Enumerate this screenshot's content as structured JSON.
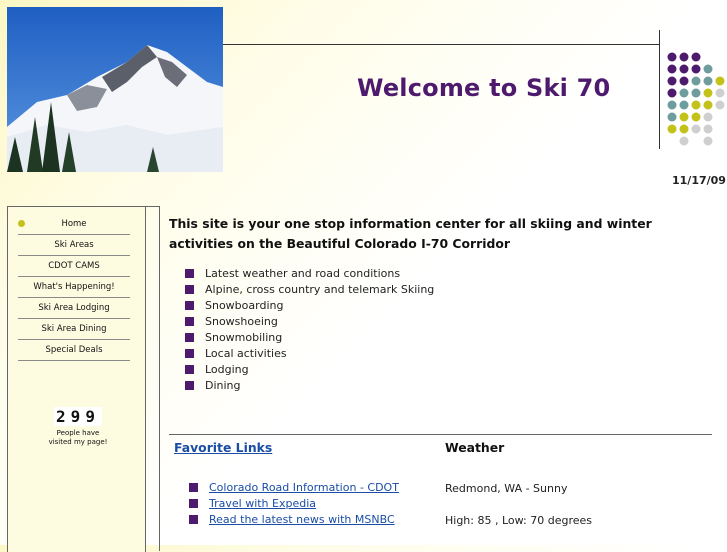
{
  "header": {
    "title": "Welcome to Ski 70",
    "date": "11/17/09"
  },
  "sidebar": {
    "items": [
      {
        "label": "Home",
        "active": true
      },
      {
        "label": "Ski Areas"
      },
      {
        "label": "CDOT CAMS"
      },
      {
        "label": "What's Happening!"
      },
      {
        "label": "Ski Area Lodging"
      },
      {
        "label": "Ski Area Dining"
      },
      {
        "label": "Special Deals"
      }
    ],
    "counter": {
      "value": "299",
      "caption_line1": "People have",
      "caption_line2": "visited my page!"
    }
  },
  "main": {
    "intro": "This site is your one stop information center for all skiing and winter activities on the Beautiful Colorado I-70 Corridor",
    "features": [
      "Latest weather and road conditions",
      "Alpine, cross country and telemark Skiing",
      "Snowboarding",
      "Snowshoeing",
      "Snowmobiling",
      "Local activities",
      "Lodging",
      "Dining"
    ],
    "favorite_links_title": "Favorite Links",
    "links": [
      "Colorado Road Information - CDOT",
      "Travel with Expedia",
      "Read the latest news with MSNBC"
    ],
    "weather_title": "Weather",
    "weather_location": "Redmond, WA - Sunny",
    "weather_temps": "High: 85 , Low: 70 degrees"
  },
  "colors": {
    "title_purple": "#4e1a6e",
    "link_blue": "#1a4da6",
    "accent_olive": "#c2c21a",
    "accent_teal": "#6f9c9c"
  }
}
